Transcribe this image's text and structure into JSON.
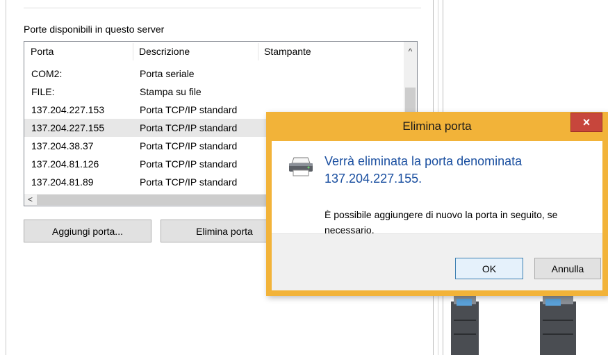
{
  "ports_section": {
    "label": "Porte disponibili in questo server",
    "columns": [
      "Porta",
      "Descrizione",
      "Stampante"
    ],
    "rows": [
      {
        "porta": "COM2:",
        "descrizione": "Porta seriale",
        "stampante": ""
      },
      {
        "porta": "FILE:",
        "descrizione": "Stampa su file",
        "stampante": ""
      },
      {
        "porta": "137.204.227.153",
        "descrizione": "Porta TCP/IP standard",
        "stampante": ""
      },
      {
        "porta": "137.204.227.155",
        "descrizione": "Porta TCP/IP standard",
        "stampante": ""
      },
      {
        "porta": "137.204.38.37",
        "descrizione": "Porta TCP/IP standard",
        "stampante": ""
      },
      {
        "porta": "137.204.81.126",
        "descrizione": "Porta TCP/IP standard",
        "stampante": ""
      },
      {
        "porta": "137.204.81.89",
        "descrizione": "Porta TCP/IP standard",
        "stampante": ""
      }
    ],
    "selected_index": 3
  },
  "buttons": {
    "add_port": "Aggiungi porta...",
    "delete_port": "Elimina porta"
  },
  "dialog": {
    "title": "Elimina porta",
    "close_glyph": "×",
    "main_line1": "Verrà eliminata la porta denominata",
    "main_line2": "137.204.227.155.",
    "sub_text": "È possibile aggiungere di nuovo la porta in seguito, se necessario.",
    "ok_label": "OK",
    "cancel_label": "Annulla",
    "icon": "printer-icon"
  },
  "scroll_glyphs": {
    "up": "^",
    "left": "<"
  },
  "colors": {
    "dialog_frame": "#f2b339",
    "close_button": "#c7463c",
    "main_instruction": "#1a4fa0",
    "selected_row": "#e7e7e7"
  }
}
